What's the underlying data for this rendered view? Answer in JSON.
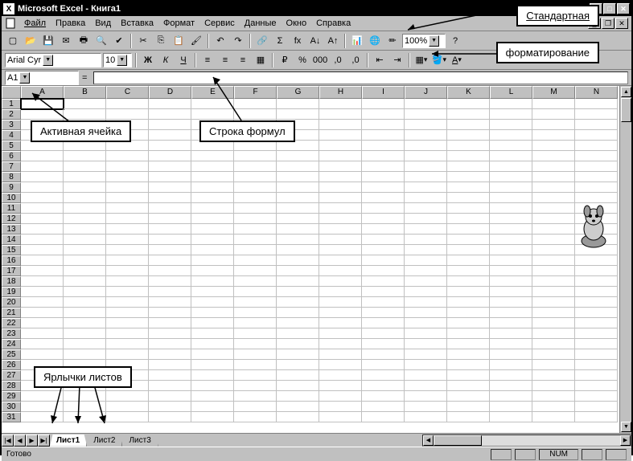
{
  "title": "Microsoft Excel - Книга1",
  "menu": [
    "Файл",
    "Правка",
    "Вид",
    "Вставка",
    "Формат",
    "Сервис",
    "Данные",
    "Окно",
    "Справка"
  ],
  "toolbar_std": {
    "zoom": "100%"
  },
  "toolbar_fmt": {
    "font": "Arial Cyr",
    "size": "10"
  },
  "namebox": "A1",
  "columns": [
    "A",
    "B",
    "C",
    "D",
    "E",
    "F",
    "G",
    "H",
    "I",
    "J",
    "K",
    "L",
    "M",
    "N"
  ],
  "rows": 31,
  "sheets": [
    "Лист1",
    "Лист2",
    "Лист3"
  ],
  "status": {
    "ready": "Готово",
    "num": "NUM"
  },
  "callouts": {
    "std": "Стандартная",
    "fmt": "форматирование",
    "active": "Активная ячейка",
    "formula": "Строка формул",
    "tabs": "Ярлычки листов"
  }
}
